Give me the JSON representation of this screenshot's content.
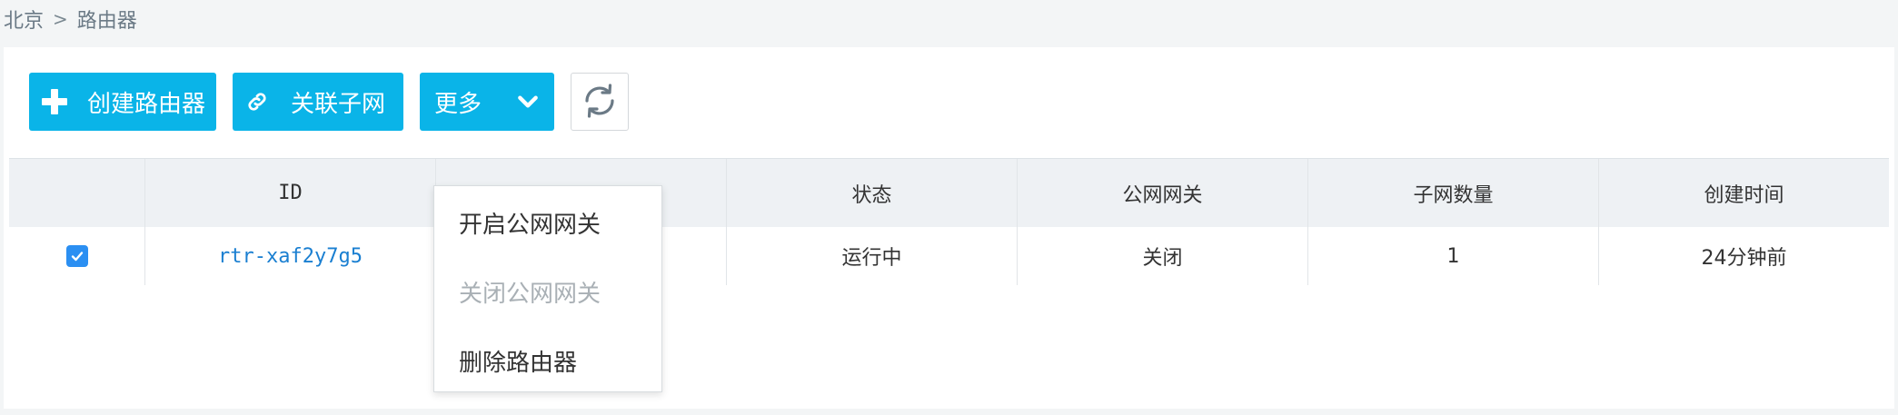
{
  "breadcrumb": {
    "region": "北京",
    "separator": ">",
    "current": "路由器"
  },
  "toolbar": {
    "create_label": "创建路由器",
    "link_label": "关联子网",
    "more_label": "更多"
  },
  "dropdown": {
    "items": [
      {
        "label": "开启公网网关",
        "disabled": false
      },
      {
        "label": "关闭公网网关",
        "disabled": true
      },
      {
        "label": "删除路由器",
        "disabled": false
      }
    ]
  },
  "table": {
    "columns": [
      "",
      "ID",
      "",
      "状态",
      "公网网关",
      "子网数量",
      "创建时间"
    ],
    "rows": [
      {
        "checked": true,
        "id": "rtr-xaf2y7g5",
        "name": "",
        "status": "运行中",
        "gateway": "关闭",
        "subnets": "1",
        "created": "24分钟前"
      }
    ]
  },
  "colors": {
    "primary": "#0ab4e8",
    "link": "#1a7fd1",
    "checkbox": "#2b8ff2"
  },
  "icons": {
    "create": "plus-icon",
    "link": "link-icon",
    "more": "chevron-down-icon",
    "refresh": "refresh-icon",
    "check": "check-icon"
  }
}
